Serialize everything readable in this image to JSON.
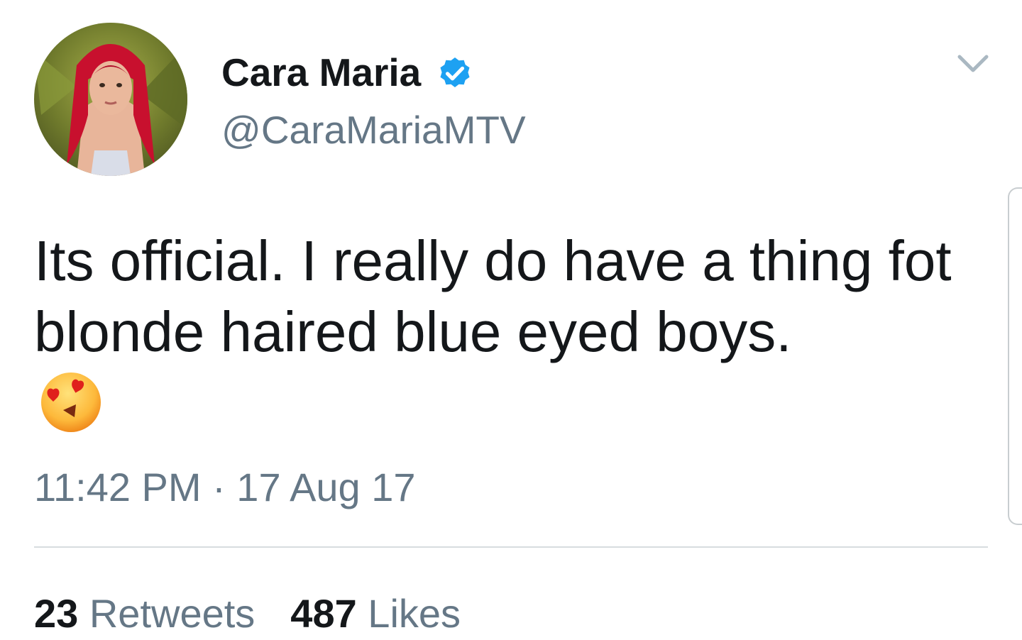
{
  "author": {
    "display_name": "Cara Maria",
    "handle": "@CaraMariaMTV",
    "verified": true,
    "avatar_icon": "profile-photo"
  },
  "tweet": {
    "text": "Its official. I really do have a thing fot blonde haired blue eyed boys.",
    "emoji": "smiling-face-with-heart-eyes",
    "timestamp": "11:42 PM · 17 Aug 17"
  },
  "stats": {
    "retweets_count": "23",
    "retweets_label": "Retweets",
    "likes_count": "487",
    "likes_label": "Likes"
  },
  "colors": {
    "primary_text": "#14171a",
    "secondary_text": "#657786",
    "verified_blue": "#1da1f2",
    "divider": "#d7dcdf"
  }
}
